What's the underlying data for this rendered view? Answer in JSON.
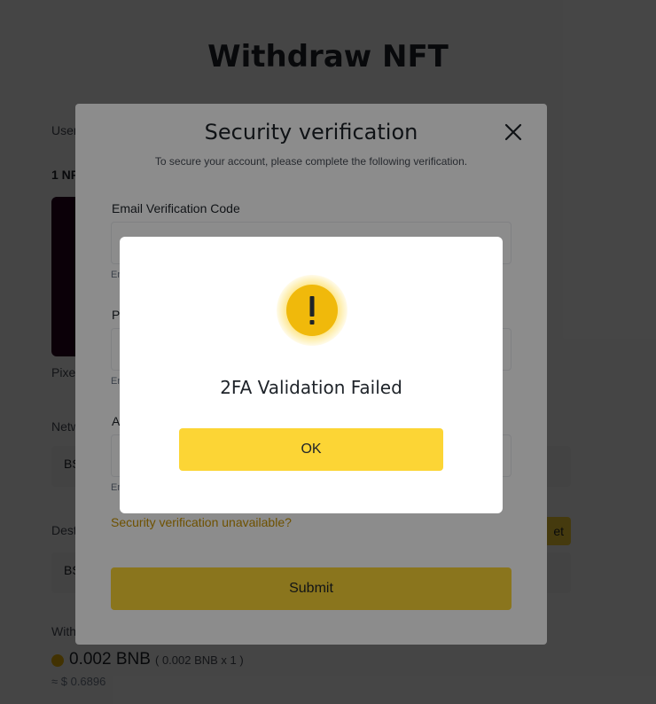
{
  "page": {
    "title": "Withdraw NFT",
    "user_label": "User",
    "nft_count_label": "1 NF",
    "nft_name": "Pixe",
    "network_label": "Netw",
    "network_value": "BS",
    "destination_label": "Dest",
    "destination_value": "BS",
    "paste_button": "et",
    "withdraw_fee_label": "With",
    "fee_amount": "0.002 BNB",
    "fee_detail": "( 0.002 BNB x 1 )",
    "fee_usd": "≈ $ 0.6896"
  },
  "security_dialog": {
    "title": "Security verification",
    "subtitle": "To secure your account, please complete the following verification.",
    "email_label": "Email Verification Code",
    "email_hint": "En",
    "phone_label": "P",
    "phone_hint": "En",
    "auth_label": "A",
    "auth_hint": "En",
    "unavailable_link": "Security verification unavailable?",
    "submit_label": "Submit"
  },
  "alert_dialog": {
    "message": "2FA Validation Failed",
    "ok_label": "OK",
    "icon": "warning-icon"
  },
  "colors": {
    "accent": "#fcd535",
    "link": "#c99400",
    "text": "#1e2329"
  }
}
